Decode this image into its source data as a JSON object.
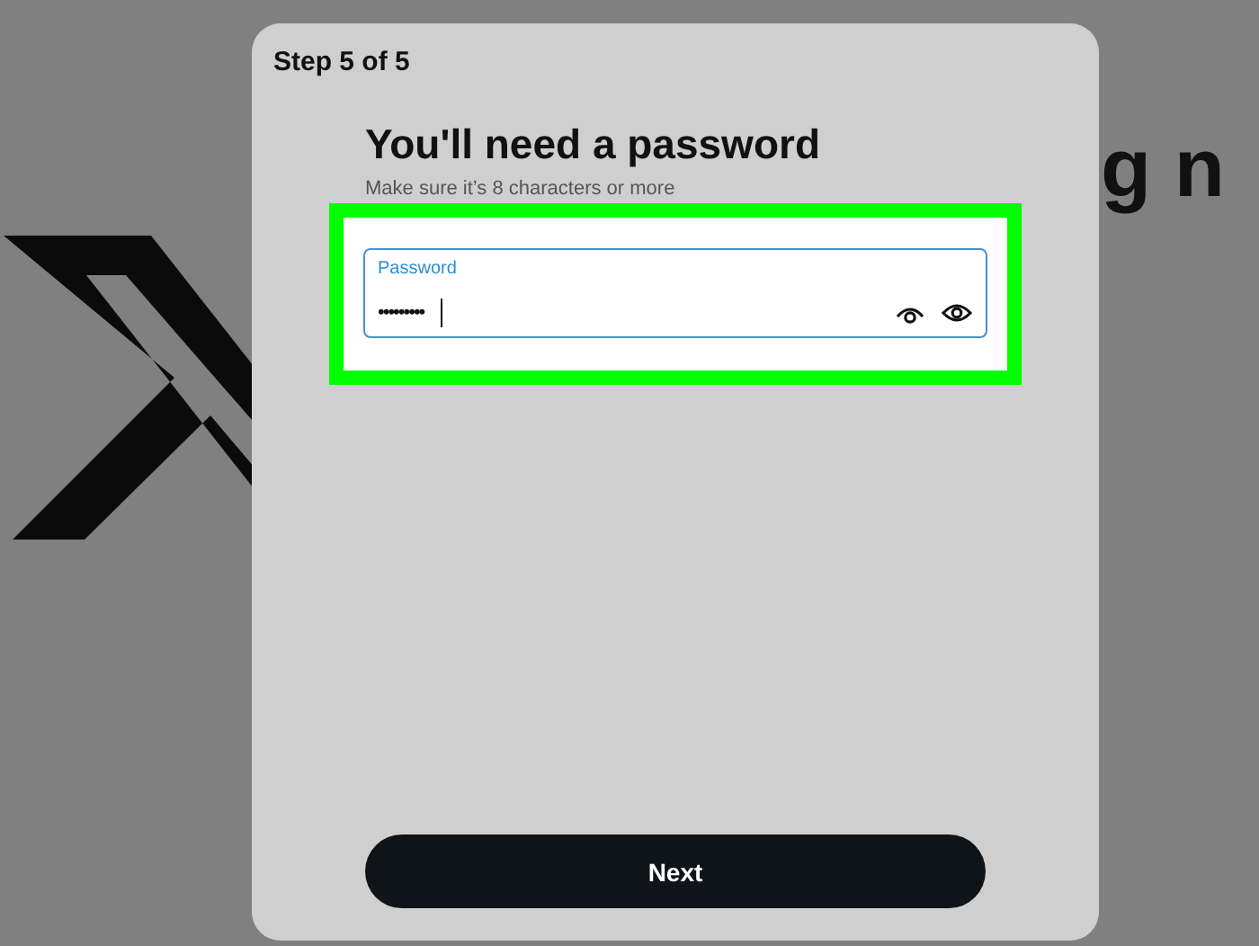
{
  "background": {
    "heading_fragment": "g n"
  },
  "dialog": {
    "step": "Step 5 of 5",
    "title": "You'll need a password",
    "subtitle": "Make sure it’s 8 characters or more",
    "password_field": {
      "label": "Password",
      "value": "•••••••••",
      "highlighted": true
    },
    "buttons": [
      {
        "label": "Next",
        "kind": "primary"
      }
    ]
  }
}
